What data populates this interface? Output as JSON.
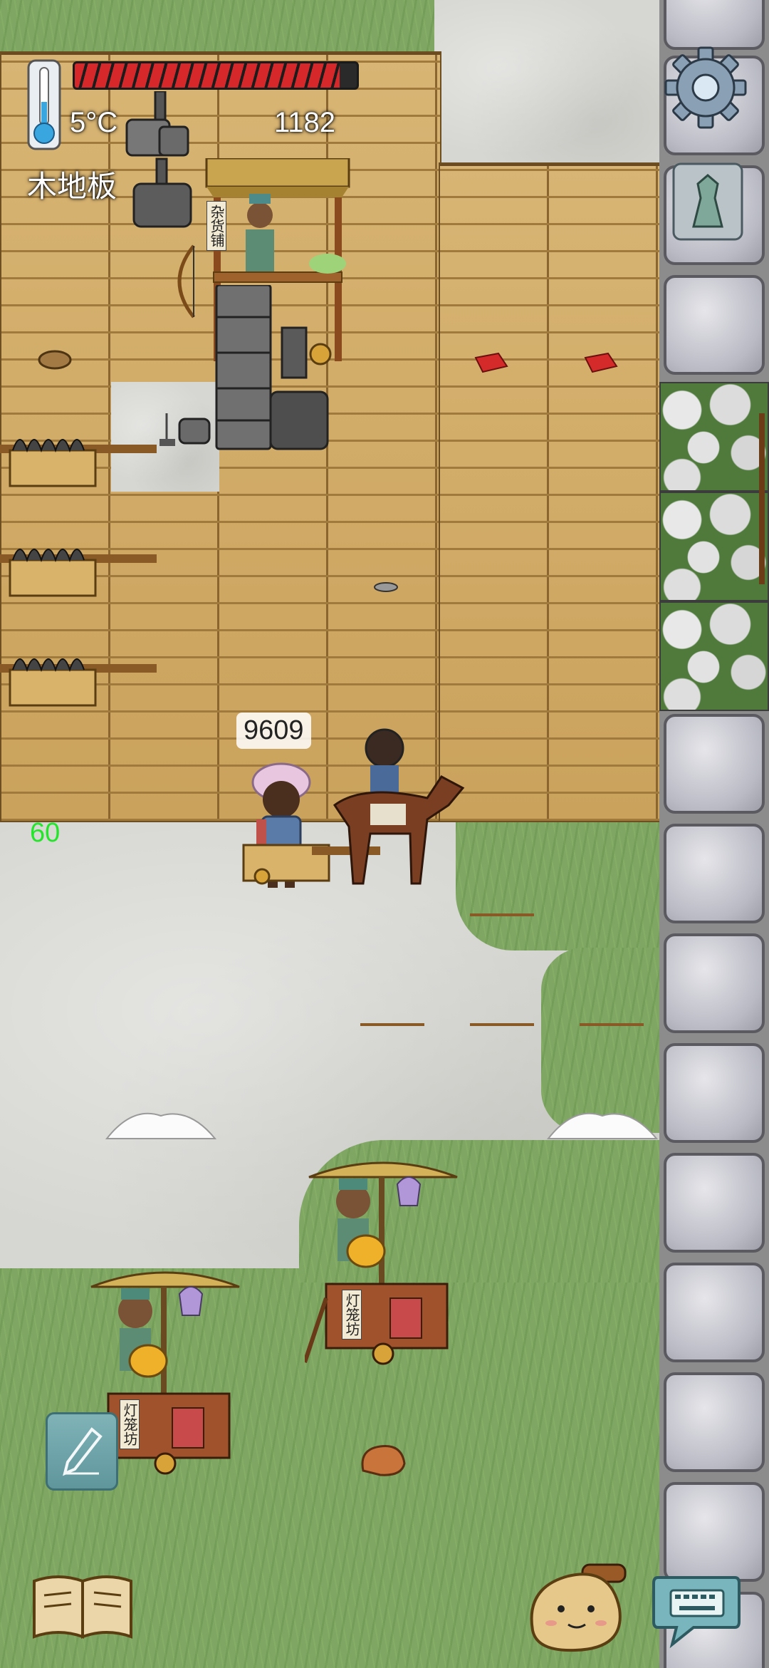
{
  "hud": {
    "temperature": "5°C",
    "tile_name": "木地板",
    "score": "1182",
    "fps": "60",
    "food_level": 0.94,
    "food_color": "#d6282a",
    "icons": {
      "thermometer": "thermometer-icon",
      "settings": "gear-icon",
      "family": "family-tree-icon",
      "pencil": "pencil-icon",
      "book": "book-icon",
      "emote": "emote-face-icon",
      "keyboard": "keyboard-chat-icon"
    }
  },
  "player": {
    "speech": "9609"
  },
  "shops": {
    "general_store_sign": "杂货铺",
    "lantern_shop_sign": "灯笼坊"
  }
}
